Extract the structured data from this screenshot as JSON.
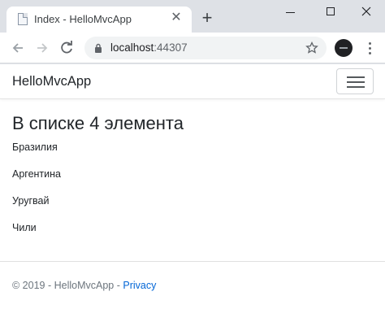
{
  "browser": {
    "tab_title": "Index - HelloMvcApp",
    "tab_close_glyph": "✕",
    "new_tab_glyph": "+",
    "url_host": "localhost",
    "url_port": ":44307"
  },
  "page": {
    "brand": "HelloMvcApp",
    "heading": "В списке 4 элемента",
    "items": [
      "Бразилия",
      "Аргентина",
      "Уругвай",
      "Чили"
    ],
    "footer_text": "© 2019 - HelloMvcApp - ",
    "footer_link": "Privacy"
  },
  "colors": {
    "link": "#0366d6",
    "chrome_bg": "#dee1e6",
    "omnibox_bg": "#f1f3f4"
  }
}
